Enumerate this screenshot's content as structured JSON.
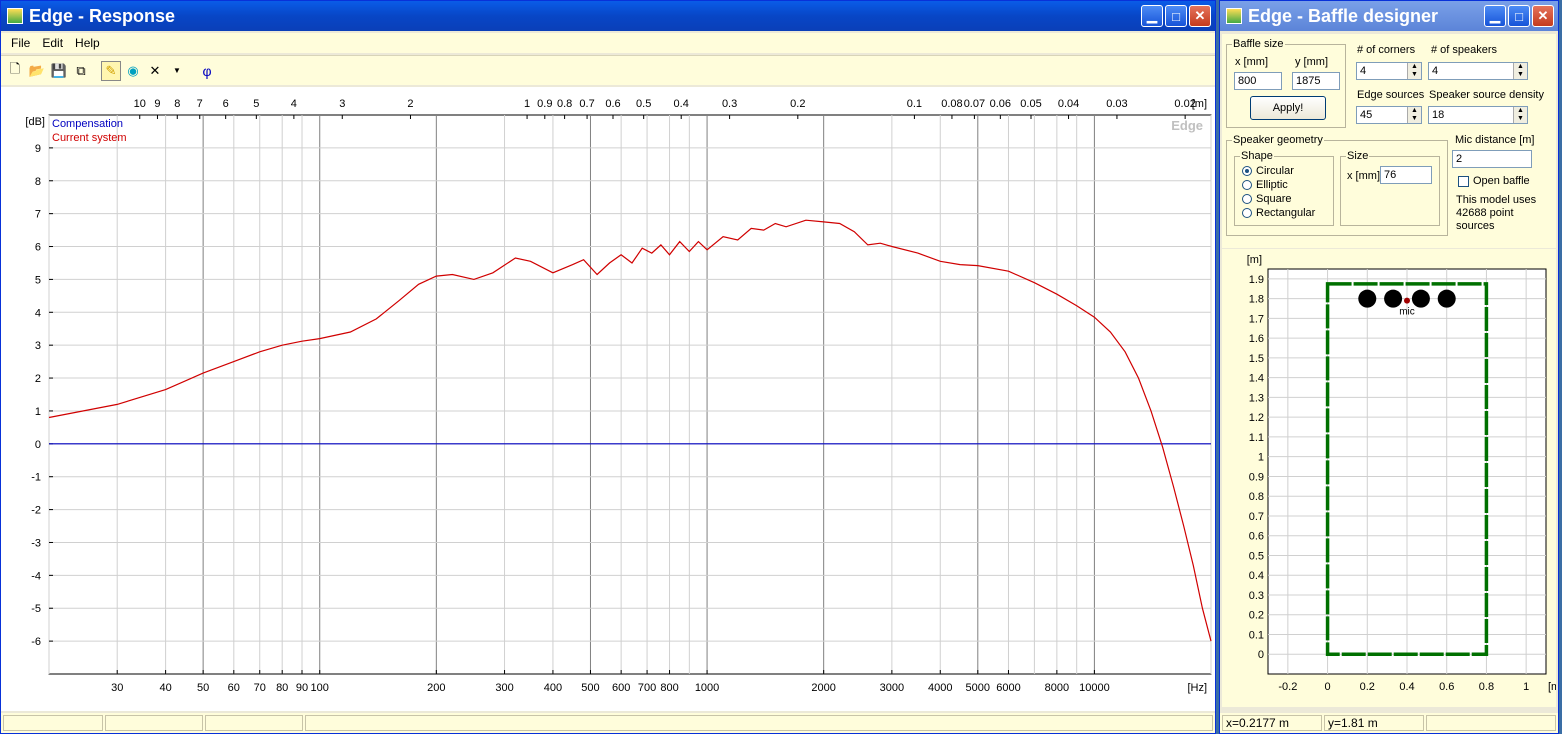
{
  "response_window": {
    "title": "Edge - Response",
    "menu": [
      "File",
      "Edit",
      "Help"
    ],
    "phi_symbol": "φ",
    "legend": [
      "Compensation",
      "Current system"
    ],
    "watermark": "Edge",
    "y_unit": "[dB]",
    "x_unit": "[Hz]",
    "top_unit": "[m]"
  },
  "chart_data": {
    "type": "line",
    "xscale": "log",
    "xlim": [
      20,
      20000
    ],
    "ylim": [
      -7,
      10
    ],
    "yticks": [
      9,
      8,
      7,
      6,
      5,
      4,
      3,
      2,
      1,
      0,
      -1,
      -2,
      -3,
      -4,
      -5,
      -6
    ],
    "xtick_labels": [
      {
        "v": 30,
        "t": "30"
      },
      {
        "v": 40,
        "t": "40"
      },
      {
        "v": 50,
        "t": "50"
      },
      {
        "v": 60,
        "t": "60"
      },
      {
        "v": 70,
        "t": "70"
      },
      {
        "v": 80,
        "t": "80"
      },
      {
        "v": 90,
        "t": "90"
      },
      {
        "v": 100,
        "t": "100"
      },
      {
        "v": 200,
        "t": "200"
      },
      {
        "v": 300,
        "t": "300"
      },
      {
        "v": 400,
        "t": "400"
      },
      {
        "v": 500,
        "t": "500"
      },
      {
        "v": 600,
        "t": "600"
      },
      {
        "v": 700,
        "t": "700"
      },
      {
        "v": 800,
        "t": "800"
      },
      {
        "v": 1000,
        "t": "1000"
      },
      {
        "v": 2000,
        "t": "2000"
      },
      {
        "v": 3000,
        "t": "3000"
      },
      {
        "v": 4000,
        "t": "4000"
      },
      {
        "v": 5000,
        "t": "5000"
      },
      {
        "v": 6000,
        "t": "6000"
      },
      {
        "v": 8000,
        "t": "8000"
      },
      {
        "v": 10000,
        "t": "10000"
      }
    ],
    "top_tick_labels": [
      {
        "m": 10,
        "t": "10"
      },
      {
        "m": 9,
        "t": "9"
      },
      {
        "m": 8,
        "t": "8"
      },
      {
        "m": 7,
        "t": "7"
      },
      {
        "m": 6,
        "t": "6"
      },
      {
        "m": 5,
        "t": "5"
      },
      {
        "m": 4,
        "t": "4"
      },
      {
        "m": 3,
        "t": "3"
      },
      {
        "m": 2,
        "t": "2"
      },
      {
        "m": 1,
        "t": "1"
      },
      {
        "m": 0.9,
        "t": "0.9"
      },
      {
        "m": 0.8,
        "t": "0.8"
      },
      {
        "m": 0.7,
        "t": "0.7"
      },
      {
        "m": 0.6,
        "t": "0.6"
      },
      {
        "m": 0.5,
        "t": "0.5"
      },
      {
        "m": 0.4,
        "t": "0.4"
      },
      {
        "m": 0.3,
        "t": "0.3"
      },
      {
        "m": 0.2,
        "t": "0.2"
      },
      {
        "m": 0.1,
        "t": "0.1"
      },
      {
        "m": 0.08,
        "t": "0.08"
      },
      {
        "m": 0.07,
        "t": "0.07"
      },
      {
        "m": 0.06,
        "t": "0.06"
      },
      {
        "m": 0.05,
        "t": "0.05"
      },
      {
        "m": 0.04,
        "t": "0.04"
      },
      {
        "m": 0.03,
        "t": "0.03"
      },
      {
        "m": 0.02,
        "t": "0.02"
      }
    ],
    "grid": true,
    "series": [
      {
        "name": "Compensation",
        "color": "#0000c0",
        "points": [
          [
            20,
            0
          ],
          [
            20000,
            0
          ]
        ]
      },
      {
        "name": "Current system",
        "color": "#d00000",
        "points": [
          [
            20,
            0.8
          ],
          [
            30,
            1.2
          ],
          [
            40,
            1.65
          ],
          [
            50,
            2.15
          ],
          [
            60,
            2.5
          ],
          [
            70,
            2.8
          ],
          [
            80,
            3.0
          ],
          [
            90,
            3.12
          ],
          [
            100,
            3.2
          ],
          [
            120,
            3.4
          ],
          [
            140,
            3.8
          ],
          [
            160,
            4.35
          ],
          [
            180,
            4.85
          ],
          [
            200,
            5.1
          ],
          [
            220,
            5.15
          ],
          [
            250,
            5.0
          ],
          [
            280,
            5.2
          ],
          [
            320,
            5.65
          ],
          [
            350,
            5.55
          ],
          [
            400,
            5.2
          ],
          [
            450,
            5.45
          ],
          [
            480,
            5.6
          ],
          [
            520,
            5.15
          ],
          [
            560,
            5.5
          ],
          [
            600,
            5.75
          ],
          [
            640,
            5.5
          ],
          [
            680,
            5.95
          ],
          [
            720,
            5.8
          ],
          [
            760,
            6.05
          ],
          [
            800,
            5.75
          ],
          [
            850,
            6.15
          ],
          [
            900,
            5.85
          ],
          [
            950,
            6.15
          ],
          [
            1000,
            5.9
          ],
          [
            1100,
            6.3
          ],
          [
            1200,
            6.2
          ],
          [
            1300,
            6.55
          ],
          [
            1400,
            6.5
          ],
          [
            1500,
            6.7
          ],
          [
            1600,
            6.6
          ],
          [
            1800,
            6.8
          ],
          [
            2000,
            6.75
          ],
          [
            2200,
            6.7
          ],
          [
            2400,
            6.45
          ],
          [
            2600,
            6.05
          ],
          [
            2800,
            6.1
          ],
          [
            3000,
            6.0
          ],
          [
            3500,
            5.8
          ],
          [
            4000,
            5.55
          ],
          [
            4500,
            5.45
          ],
          [
            5000,
            5.42
          ],
          [
            6000,
            5.25
          ],
          [
            7000,
            4.9
          ],
          [
            8000,
            4.55
          ],
          [
            9000,
            4.2
          ],
          [
            10000,
            3.85
          ],
          [
            11000,
            3.4
          ],
          [
            12000,
            2.8
          ],
          [
            13000,
            2.0
          ],
          [
            14000,
            1.0
          ],
          [
            15000,
            -0.1
          ],
          [
            16000,
            -1.3
          ],
          [
            17000,
            -2.5
          ],
          [
            18000,
            -3.7
          ],
          [
            19000,
            -5.0
          ],
          [
            20000,
            -6.0
          ]
        ]
      }
    ]
  },
  "baffle_window": {
    "title": "Edge - Baffle designer",
    "baffle_size_label": "Baffle size",
    "x_label": "x [mm]",
    "y_label": "y [mm]",
    "x_value": "800",
    "y_value": "1875",
    "apply_label": "Apply!",
    "corners_label": "# of corners",
    "corners_value": "4",
    "speakers_label": "# of speakers",
    "speakers_value": "4",
    "edge_sources_label": "Edge sources",
    "edge_sources_value": "45",
    "density_label": "Speaker source density",
    "density_value": "18",
    "geometry_label": "Speaker geometry",
    "shape_label": "Shape",
    "shapes": [
      "Circular",
      "Elliptic",
      "Square",
      "Rectangular"
    ],
    "selected_shape": "Circular",
    "size_label": "Size",
    "size_x_label": "x [mm]",
    "size_x_value": "76",
    "mic_distance_label": "Mic distance [m]",
    "mic_distance_value": "2",
    "open_baffle_label": "Open baffle",
    "open_baffle_checked": false,
    "model_info": [
      "This model uses",
      "42688 point",
      "sources"
    ],
    "status_x": "x=0.2177 m",
    "status_y": "y=1.81 m"
  },
  "baffle_plot": {
    "x_unit": "[m]",
    "y_unit": "[m]",
    "xlim": [
      -0.3,
      1.1
    ],
    "ylim": [
      -0.1,
      1.95
    ],
    "x_ticks": [
      -0.2,
      0,
      0.2,
      0.4,
      0.6,
      0.8,
      1
    ],
    "y_ticks": [
      0,
      0.1,
      0.2,
      0.3,
      0.4,
      0.5,
      0.6,
      0.7,
      0.8,
      0.9,
      1,
      1.1,
      1.2,
      1.3,
      1.4,
      1.5,
      1.6,
      1.7,
      1.8,
      1.9
    ],
    "baffle_width": 0.8,
    "baffle_height": 1.875,
    "speaker_x": [
      0.2,
      0.33,
      0.47,
      0.6
    ],
    "speaker_y": 1.8,
    "mic_label": "mic",
    "mic_x": 0.4,
    "mic_y": 1.79,
    "edge_color": "#007000",
    "speaker_color": "#000000",
    "mic_color": "#a00000"
  }
}
